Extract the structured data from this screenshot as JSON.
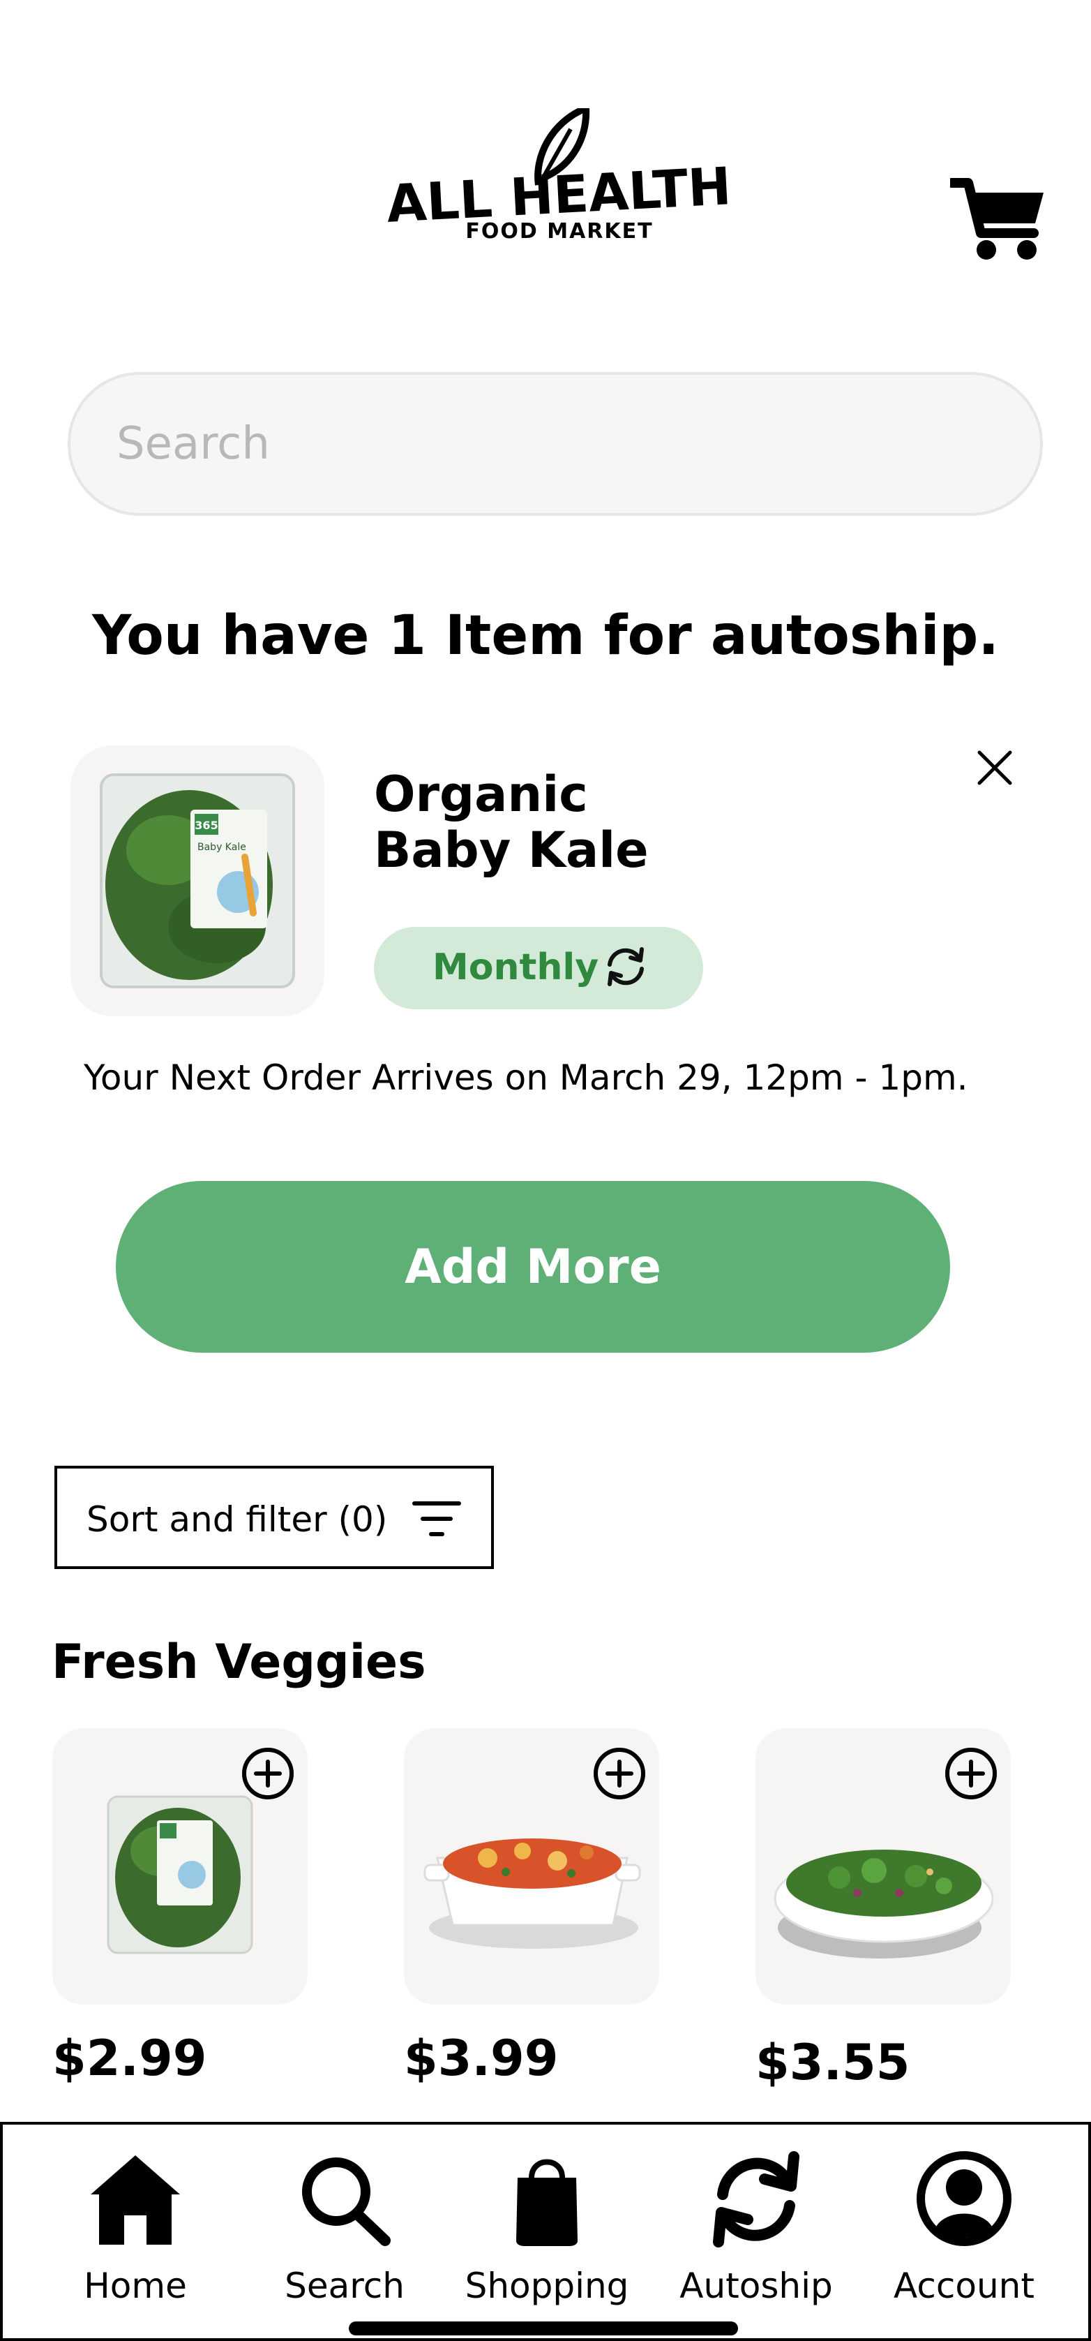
{
  "header": {
    "logo": {
      "line1": "ALL HEALTH",
      "line2": "FOOD MARKET",
      "icon": "leaf-icon"
    },
    "cart_icon": "cart-icon"
  },
  "search": {
    "placeholder": "Search",
    "value": ""
  },
  "autoship": {
    "headline": "You have 1 Item for autoship.",
    "item": {
      "name_line1": "Organic",
      "name_line2": "Baby Kale",
      "frequency": "Monthly",
      "frequency_icon": "refresh-icon",
      "remove_icon": "close-icon",
      "package_label": "Baby Kale",
      "brand_badge": "365"
    },
    "next_order": "Your Next Order Arrives on March 29, 12pm - 1pm.",
    "add_more_label": "Add More"
  },
  "filters": {
    "sort_label": "Sort and filter (0)",
    "icon": "filter-icon"
  },
  "section": {
    "title": "Fresh Veggies",
    "products": [
      {
        "price": "$2.99",
        "image": "baby-kale-package"
      },
      {
        "price": "$3.99",
        "image": "roasted-veggies-dish"
      },
      {
        "price": "$3.55",
        "image": "broccoli-salad-bowl"
      }
    ]
  },
  "nav": {
    "items": [
      {
        "label": "Home",
        "icon": "home-icon"
      },
      {
        "label": "Search",
        "icon": "search-icon"
      },
      {
        "label": "Shopping",
        "icon": "shopping-bag-icon"
      },
      {
        "label": "Autoship",
        "icon": "refresh-icon"
      },
      {
        "label": "Account",
        "icon": "account-icon"
      }
    ]
  },
  "colors": {
    "accent_green": "#5fb077",
    "pill_bg": "#d3ead9",
    "pill_text": "#2f8a3e",
    "thumb_bg": "#f6f5f3"
  }
}
